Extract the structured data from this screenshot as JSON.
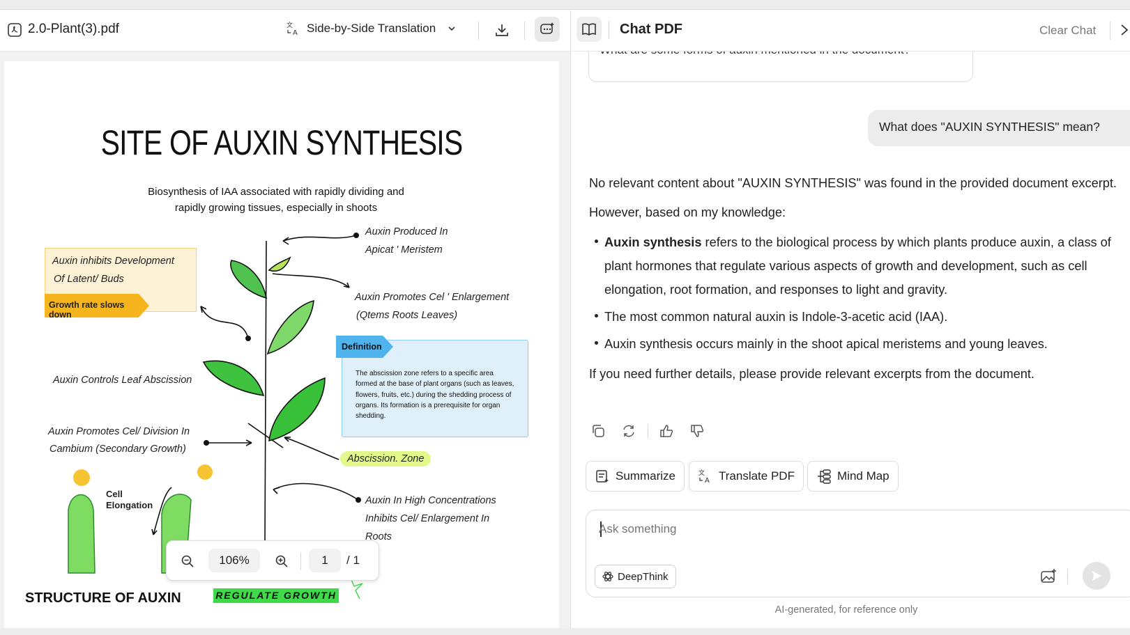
{
  "pdf_header": {
    "filename": "2.0-Plant(3).pdf",
    "translation_mode": "Side-by-Side Translation"
  },
  "document": {
    "title": "SITE OF AUXIN SYNTHESIS",
    "subtitle_line1": "Biosynthesis of IAA associated with rapidly dividing and",
    "subtitle_line2": "rapidly growing tissues, especially in shoots",
    "note_box": {
      "line1": "Auxin inhibits Development",
      "line2": "Of Latent/ Buds",
      "tag": "Growth rate slows down"
    },
    "labels": {
      "apical1": "Auxin Produced In",
      "apical2": "Apicat ' Meristem",
      "enlarge1": "Auxin Promotes Cel ' Enlargement",
      "enlarge2": "(Qtems Roots Leaves)",
      "abscission": "Auxin Controls Leaf Abscission",
      "division1": "Auxin Promotes Cel/ Division In",
      "division2": "Cambium (Secondary Growth)",
      "zone": "Abscission. Zone",
      "high1": "Auxin In High Concentrations",
      "high2": "Inhibits Cel/ Enlargement In",
      "high3": "Roots",
      "cell1": "Cell",
      "cell2": "Elongation"
    },
    "definition": {
      "tag": "Definition",
      "text": "The abscission zone refers to a specific area formed at the base of plant organs (such as leaves, flowers, fruits, etc.) during the shedding process of organs. Its formation is a prerequisite for organ shedding."
    },
    "bottom_left": "STRUCTURE OF AUXIN",
    "bottom_banner": "REGULATE GROWTH"
  },
  "zoombar": {
    "zoom": "106%",
    "page": "1",
    "total": "/ 1"
  },
  "chat": {
    "title": "Chat PDF",
    "clear": "Clear Chat",
    "prev_question": "What are some forms of auxin mentioned in the document?",
    "user_msg": "What does \"AUXIN SYNTHESIS\" mean?",
    "p1": "No relevant content about \"AUXIN SYNTHESIS\" was found in the provided document excerpt.",
    "p2": "However, based on my knowledge:",
    "b1_bold": "Auxin synthesis",
    "b1_rest": " refers to the biological process by which plants produce auxin, a class of plant hormones that regulate various aspects of growth and development, such as cell elongation, root formation, and responses to light and gravity.",
    "b2": "The most common natural auxin is Indole-3-acetic acid (IAA).",
    "b3": "Auxin synthesis occurs mainly in the shoot apical meristems and young leaves.",
    "p3": "If you need further details, please provide relevant excerpts from the document.",
    "actions": {
      "summarize": "Summarize",
      "translate": "Translate PDF",
      "mindmap": "Mind Map"
    },
    "input_placeholder": "Ask something",
    "deepthink": "DeepThink",
    "disclaimer": "AI-generated, for reference only"
  },
  "colors": {
    "accent": "#f6b51c",
    "definition_bg": "#dff0fb",
    "zone_bg": "#e3f98a",
    "leaf": "#4fc24f",
    "banner": "#3fd94a"
  }
}
